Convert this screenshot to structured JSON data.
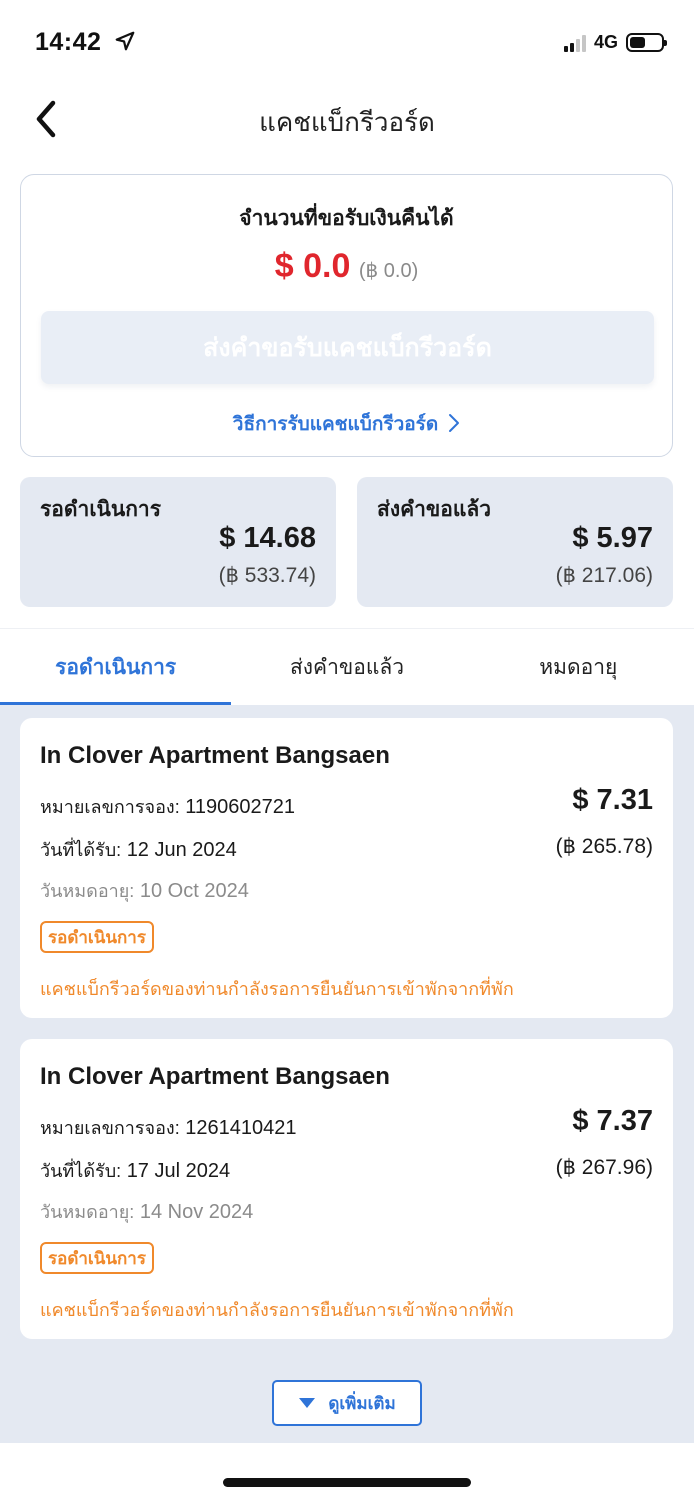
{
  "status_bar": {
    "time": "14:42",
    "network": "4G"
  },
  "header": {
    "title": "แคชแบ็กรีวอร์ด"
  },
  "summary": {
    "label": "จำนวนที่ขอรับเงินคืนได้",
    "amount_usd": "$ 0.0",
    "amount_thb": "(฿ 0.0)",
    "claim_button_label": "ส่งคำขอรับแคชแบ็กรีวอร์ด",
    "howto_link_label": "วิธีการรับแคชแบ็กรีวอร์ด"
  },
  "stats": {
    "pending": {
      "label": "รอดำเนินการ",
      "usd": "$ 14.68",
      "thb": "(฿ 533.74)"
    },
    "requested": {
      "label": "ส่งคำขอแล้ว",
      "usd": "$ 5.97",
      "thb": "(฿ 217.06)"
    }
  },
  "tabs": [
    {
      "label": "รอดำเนินการ",
      "active": true
    },
    {
      "label": "ส่งคำขอแล้ว",
      "active": false
    },
    {
      "label": "หมดอายุ",
      "active": false
    }
  ],
  "bookings": [
    {
      "name": "In Clover Apartment Bangsaen",
      "booking_label": "หมายเลขการจอง:",
      "booking_number": "1190602721",
      "received_label": "วันที่ได้รับ:",
      "received_date": "12 Jun 2024",
      "expiry_label": "วันหมดอายุ:",
      "expiry_date": "10 Oct 2024",
      "amount_usd": "$ 7.31",
      "amount_thb": "(฿ 265.78)",
      "status": "รอดำเนินการ",
      "note": "แคชแบ็กรีวอร์ดของท่านกำลังรอการยืนยันการเข้าพักจากที่พัก"
    },
    {
      "name": "In Clover Apartment Bangsaen",
      "booking_label": "หมายเลขการจอง:",
      "booking_number": "1261410421",
      "received_label": "วันที่ได้รับ:",
      "received_date": "17 Jul 2024",
      "expiry_label": "วันหมดอายุ:",
      "expiry_date": "14 Nov 2024",
      "amount_usd": "$ 7.37",
      "amount_thb": "(฿ 267.96)",
      "status": "รอดำเนินการ",
      "note": "แคชแบ็กรีวอร์ดของท่านกำลังรอการยืนยันการเข้าพักจากที่พัก"
    }
  ],
  "more_button_label": "ดูเพิ่มเติม",
  "colors": {
    "accent": "#2f74d8",
    "amount_red": "#e0262d",
    "pending_orange": "#f0892b",
    "panel_bg": "#e4e9f2"
  },
  "icons": {
    "location": "location-arrow-icon",
    "back": "chevron-left-icon",
    "howto": "chevron-right-icon",
    "more": "triangle-down-icon"
  }
}
